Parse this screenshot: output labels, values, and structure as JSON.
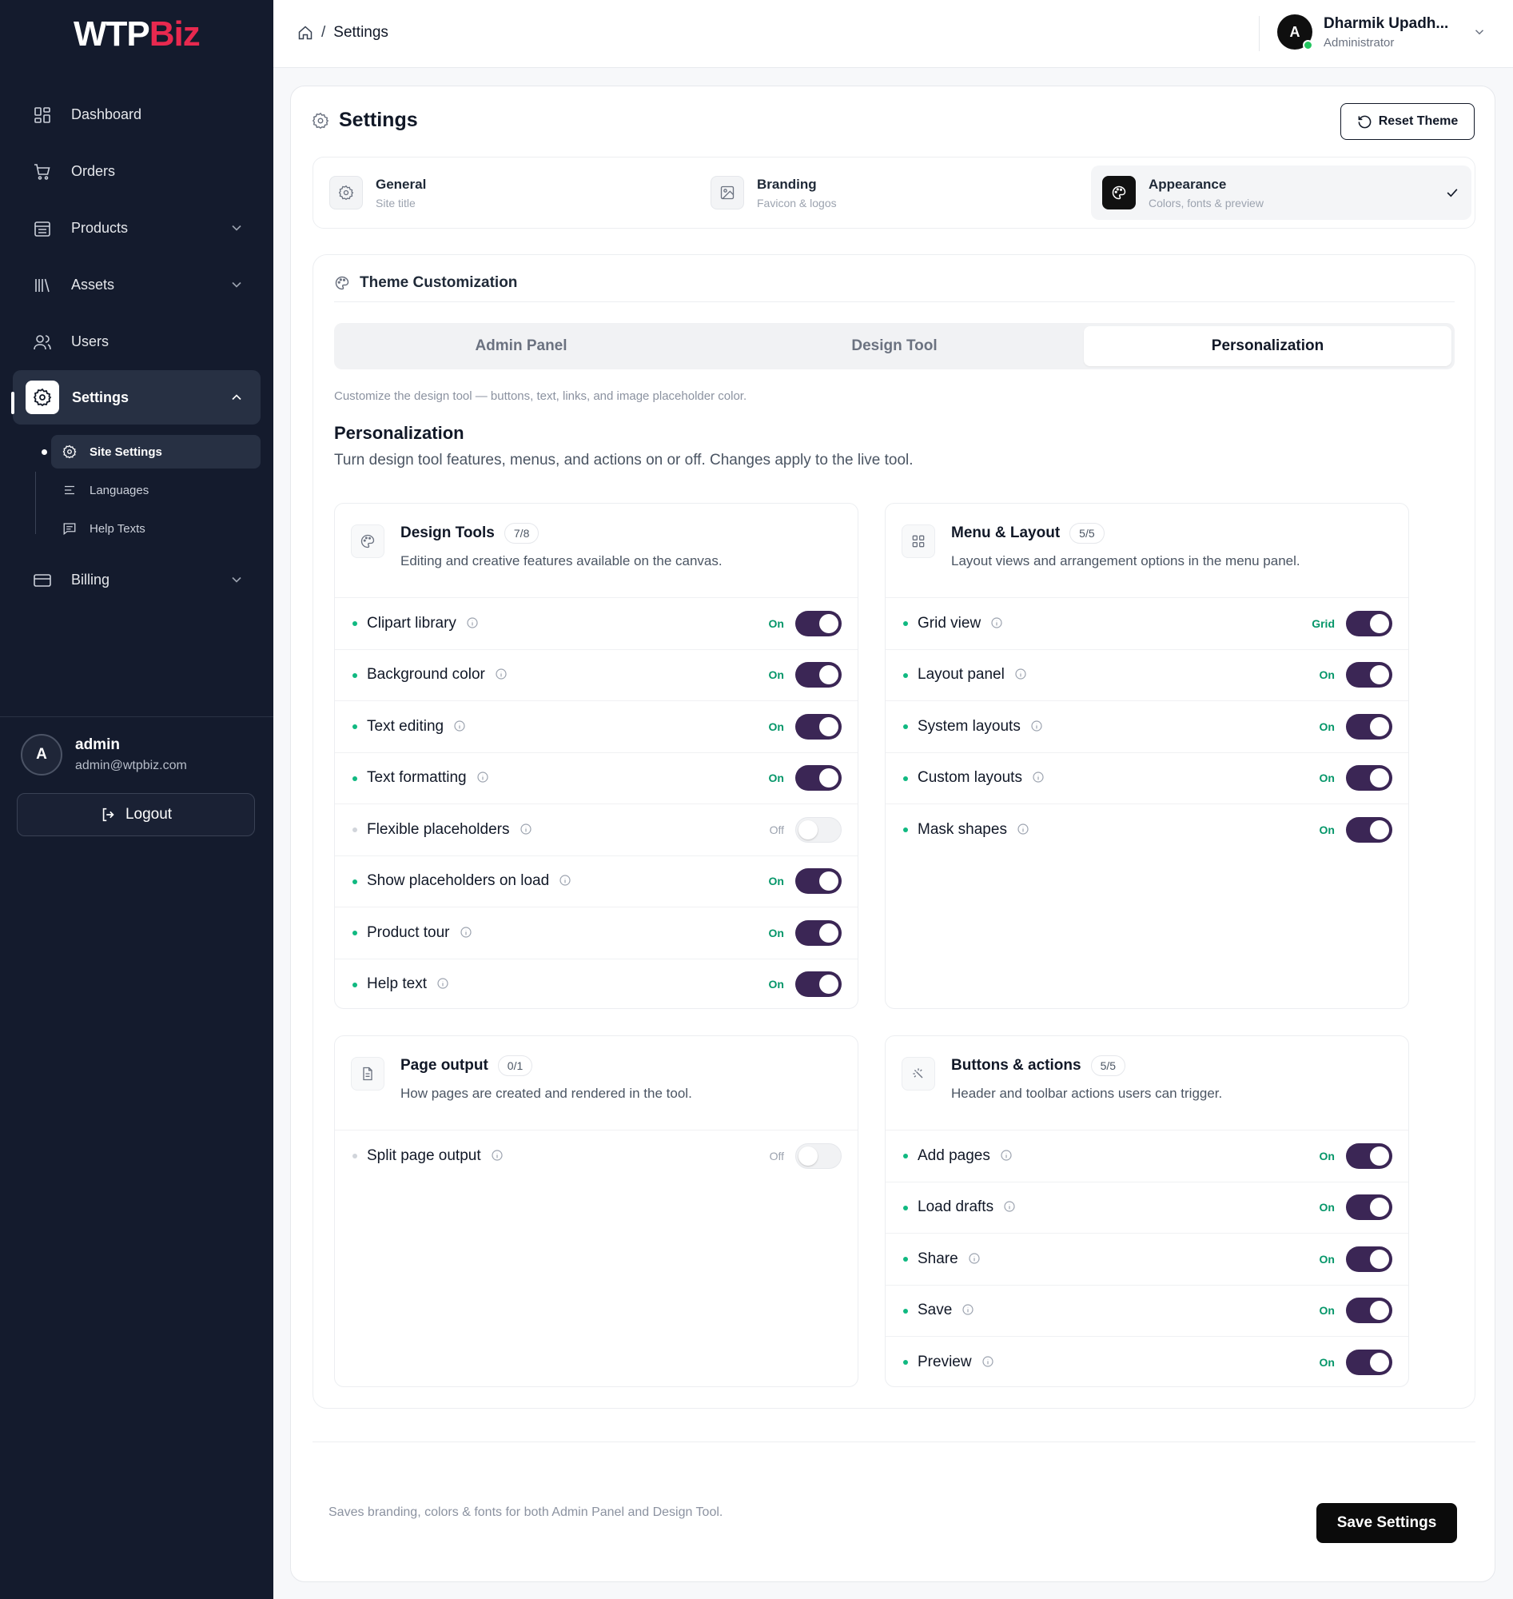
{
  "brand": {
    "part1": "WTP",
    "part2": "Biz",
    "accent": "#e8294f"
  },
  "sidebar": {
    "items": [
      {
        "label": "Dashboard",
        "icon": "dashboard-icon"
      },
      {
        "label": "Orders",
        "icon": "cart-icon"
      },
      {
        "label": "Products",
        "icon": "products-icon",
        "expandable": true
      },
      {
        "label": "Assets",
        "icon": "library-icon",
        "expandable": true
      },
      {
        "label": "Users",
        "icon": "users-icon"
      },
      {
        "label": "Settings",
        "icon": "gear-icon",
        "expandable": true,
        "active": true
      }
    ],
    "subitems": [
      {
        "label": "Site Settings",
        "icon": "gear-icon",
        "active": true
      },
      {
        "label": "Languages",
        "icon": "lines-icon"
      },
      {
        "label": "Help Texts",
        "icon": "message-icon"
      }
    ],
    "billing": {
      "label": "Billing",
      "icon": "card-icon"
    },
    "user": {
      "initial": "A",
      "name": "admin",
      "email": "admin@wtpbiz.com"
    },
    "logout_label": "Logout"
  },
  "topbar": {
    "breadcrumb": "Settings",
    "profile": {
      "initial": "A",
      "name": "Dharmik Upadh...",
      "role": "Administrator"
    }
  },
  "main": {
    "title": "Settings",
    "reset_label": "Reset Theme",
    "steps": [
      {
        "title": "General",
        "sub": "Site title",
        "icon": "gear-icon"
      },
      {
        "title": "Branding",
        "sub": "Favicon & logos",
        "icon": "image-icon"
      },
      {
        "title": "Appearance",
        "sub": "Colors, fonts & preview",
        "icon": "palette-icon",
        "active": true
      }
    ],
    "theme": {
      "heading": "Theme Customization",
      "tabs": [
        "Admin Panel",
        "Design Tool",
        "Personalization"
      ],
      "active_tab": 2,
      "desc": "Customize the design tool — buttons, text, links, and image placeholder color.",
      "section_title": "Personalization",
      "section_sub": "Turn design tool features, menus, and actions on or off. Changes apply to the live tool."
    },
    "groups": [
      {
        "title": "Design Tools",
        "badge": "7/8",
        "icon": "palette-icon",
        "desc": "Editing and creative features available on the canvas.",
        "rows": [
          {
            "label": "Clipart library",
            "state": "On",
            "on": true
          },
          {
            "label": "Background color",
            "state": "On",
            "on": true
          },
          {
            "label": "Text editing",
            "state": "On",
            "on": true
          },
          {
            "label": "Text formatting",
            "state": "On",
            "on": true
          },
          {
            "label": "Flexible placeholders",
            "state": "Off",
            "on": false
          },
          {
            "label": "Show placeholders on load",
            "state": "On",
            "on": true
          },
          {
            "label": "Product tour",
            "state": "On",
            "on": true
          },
          {
            "label": "Help text",
            "state": "On",
            "on": true
          }
        ]
      },
      {
        "title": "Menu & Layout",
        "badge": "5/5",
        "icon": "grid-icon",
        "desc": "Layout views and arrangement options in the menu panel.",
        "rows": [
          {
            "label": "Grid view",
            "state": "Grid",
            "on": true
          },
          {
            "label": "Layout panel",
            "state": "On",
            "on": true
          },
          {
            "label": "System layouts",
            "state": "On",
            "on": true
          },
          {
            "label": "Custom layouts",
            "state": "On",
            "on": true
          },
          {
            "label": "Mask shapes",
            "state": "On",
            "on": true
          }
        ]
      },
      {
        "title": "Page output",
        "badge": "0/1",
        "icon": "document-icon",
        "desc": "How pages are created and rendered in the tool.",
        "rows": [
          {
            "label": "Split page output",
            "state": "Off",
            "on": false
          }
        ]
      },
      {
        "title": "Buttons & actions",
        "badge": "5/5",
        "icon": "sparkle-icon",
        "desc": "Header and toolbar actions users can trigger.",
        "rows": [
          {
            "label": "Add pages",
            "state": "On",
            "on": true
          },
          {
            "label": "Load drafts",
            "state": "On",
            "on": true
          },
          {
            "label": "Share",
            "state": "On",
            "on": true
          },
          {
            "label": "Save",
            "state": "On",
            "on": true
          },
          {
            "label": "Preview",
            "state": "On",
            "on": true
          }
        ]
      }
    ],
    "footer_note": "Saves branding, colors & fonts for both Admin Panel and Design Tool.",
    "save_label": "Save Settings"
  }
}
